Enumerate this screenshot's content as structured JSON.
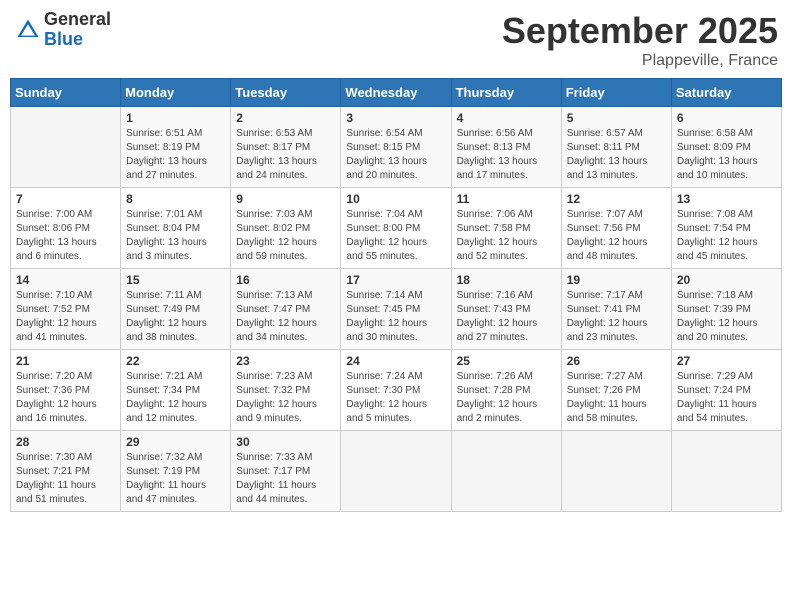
{
  "header": {
    "logo": {
      "general": "General",
      "blue": "Blue"
    },
    "title": "September 2025",
    "location": "Plappeville, France"
  },
  "calendar": {
    "weekdays": [
      "Sunday",
      "Monday",
      "Tuesday",
      "Wednesday",
      "Thursday",
      "Friday",
      "Saturday"
    ],
    "weeks": [
      [
        {
          "day": "",
          "info": ""
        },
        {
          "day": "1",
          "info": "Sunrise: 6:51 AM\nSunset: 8:19 PM\nDaylight: 13 hours\nand 27 minutes."
        },
        {
          "day": "2",
          "info": "Sunrise: 6:53 AM\nSunset: 8:17 PM\nDaylight: 13 hours\nand 24 minutes."
        },
        {
          "day": "3",
          "info": "Sunrise: 6:54 AM\nSunset: 8:15 PM\nDaylight: 13 hours\nand 20 minutes."
        },
        {
          "day": "4",
          "info": "Sunrise: 6:56 AM\nSunset: 8:13 PM\nDaylight: 13 hours\nand 17 minutes."
        },
        {
          "day": "5",
          "info": "Sunrise: 6:57 AM\nSunset: 8:11 PM\nDaylight: 13 hours\nand 13 minutes."
        },
        {
          "day": "6",
          "info": "Sunrise: 6:58 AM\nSunset: 8:09 PM\nDaylight: 13 hours\nand 10 minutes."
        }
      ],
      [
        {
          "day": "7",
          "info": "Sunrise: 7:00 AM\nSunset: 8:06 PM\nDaylight: 13 hours\nand 6 minutes."
        },
        {
          "day": "8",
          "info": "Sunrise: 7:01 AM\nSunset: 8:04 PM\nDaylight: 13 hours\nand 3 minutes."
        },
        {
          "day": "9",
          "info": "Sunrise: 7:03 AM\nSunset: 8:02 PM\nDaylight: 12 hours\nand 59 minutes."
        },
        {
          "day": "10",
          "info": "Sunrise: 7:04 AM\nSunset: 8:00 PM\nDaylight: 12 hours\nand 55 minutes."
        },
        {
          "day": "11",
          "info": "Sunrise: 7:06 AM\nSunset: 7:58 PM\nDaylight: 12 hours\nand 52 minutes."
        },
        {
          "day": "12",
          "info": "Sunrise: 7:07 AM\nSunset: 7:56 PM\nDaylight: 12 hours\nand 48 minutes."
        },
        {
          "day": "13",
          "info": "Sunrise: 7:08 AM\nSunset: 7:54 PM\nDaylight: 12 hours\nand 45 minutes."
        }
      ],
      [
        {
          "day": "14",
          "info": "Sunrise: 7:10 AM\nSunset: 7:52 PM\nDaylight: 12 hours\nand 41 minutes."
        },
        {
          "day": "15",
          "info": "Sunrise: 7:11 AM\nSunset: 7:49 PM\nDaylight: 12 hours\nand 38 minutes."
        },
        {
          "day": "16",
          "info": "Sunrise: 7:13 AM\nSunset: 7:47 PM\nDaylight: 12 hours\nand 34 minutes."
        },
        {
          "day": "17",
          "info": "Sunrise: 7:14 AM\nSunset: 7:45 PM\nDaylight: 12 hours\nand 30 minutes."
        },
        {
          "day": "18",
          "info": "Sunrise: 7:16 AM\nSunset: 7:43 PM\nDaylight: 12 hours\nand 27 minutes."
        },
        {
          "day": "19",
          "info": "Sunrise: 7:17 AM\nSunset: 7:41 PM\nDaylight: 12 hours\nand 23 minutes."
        },
        {
          "day": "20",
          "info": "Sunrise: 7:18 AM\nSunset: 7:39 PM\nDaylight: 12 hours\nand 20 minutes."
        }
      ],
      [
        {
          "day": "21",
          "info": "Sunrise: 7:20 AM\nSunset: 7:36 PM\nDaylight: 12 hours\nand 16 minutes."
        },
        {
          "day": "22",
          "info": "Sunrise: 7:21 AM\nSunset: 7:34 PM\nDaylight: 12 hours\nand 12 minutes."
        },
        {
          "day": "23",
          "info": "Sunrise: 7:23 AM\nSunset: 7:32 PM\nDaylight: 12 hours\nand 9 minutes."
        },
        {
          "day": "24",
          "info": "Sunrise: 7:24 AM\nSunset: 7:30 PM\nDaylight: 12 hours\nand 5 minutes."
        },
        {
          "day": "25",
          "info": "Sunrise: 7:26 AM\nSunset: 7:28 PM\nDaylight: 12 hours\nand 2 minutes."
        },
        {
          "day": "26",
          "info": "Sunrise: 7:27 AM\nSunset: 7:26 PM\nDaylight: 11 hours\nand 58 minutes."
        },
        {
          "day": "27",
          "info": "Sunrise: 7:29 AM\nSunset: 7:24 PM\nDaylight: 11 hours\nand 54 minutes."
        }
      ],
      [
        {
          "day": "28",
          "info": "Sunrise: 7:30 AM\nSunset: 7:21 PM\nDaylight: 11 hours\nand 51 minutes."
        },
        {
          "day": "29",
          "info": "Sunrise: 7:32 AM\nSunset: 7:19 PM\nDaylight: 11 hours\nand 47 minutes."
        },
        {
          "day": "30",
          "info": "Sunrise: 7:33 AM\nSunset: 7:17 PM\nDaylight: 11 hours\nand 44 minutes."
        },
        {
          "day": "",
          "info": ""
        },
        {
          "day": "",
          "info": ""
        },
        {
          "day": "",
          "info": ""
        },
        {
          "day": "",
          "info": ""
        }
      ]
    ]
  }
}
